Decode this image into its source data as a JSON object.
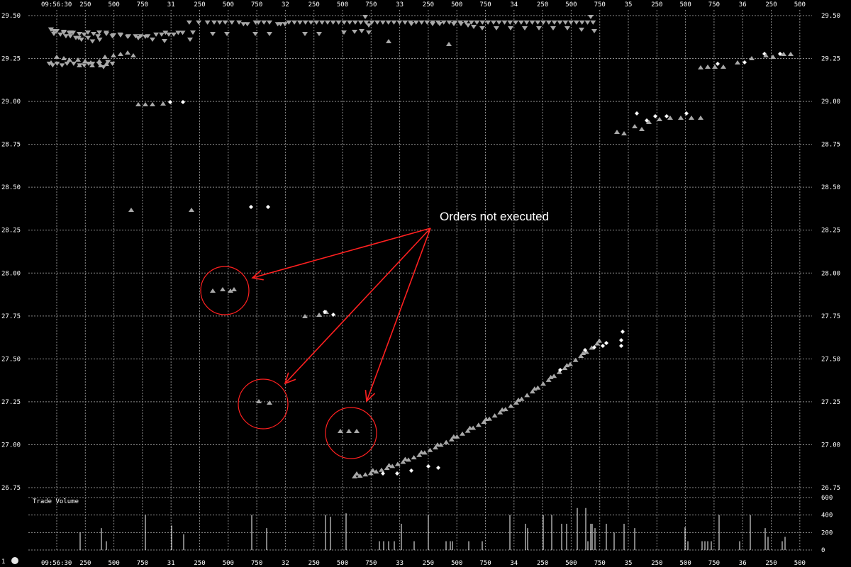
{
  "chart_data": [
    {
      "type": "scatter",
      "title": "",
      "xlabel": "",
      "ylabel": "",
      "ylim": [
        26.75,
        29.5
      ],
      "y_ticks": [
        "29.50",
        "29.25",
        "29.00",
        "28.75",
        "28.50",
        "28.25",
        "28.00",
        "27.75",
        "27.50",
        "27.25",
        "27.00",
        "26.75"
      ],
      "x_tick_labels": [
        "09:56:30",
        "250",
        "500",
        "750",
        "31",
        "250",
        "500",
        "750",
        "32",
        "250",
        "500",
        "750",
        "33",
        "250",
        "500",
        "750",
        "34",
        "250",
        "500",
        "750",
        "35",
        "250",
        "500",
        "750",
        "36",
        "250",
        "500"
      ],
      "grid": true,
      "series": [
        {
          "marker": "triangle-down",
          "color": "#a8a8a8",
          "points": [
            [
              0.5,
              29.42
            ],
            [
              1.0,
              29.41
            ],
            [
              1.5,
              29.41
            ],
            [
              2.2,
              29.39
            ],
            [
              2.8,
              29.4
            ],
            [
              3.2,
              29.38
            ],
            [
              3.8,
              29.4
            ],
            [
              4.0,
              29.38
            ],
            [
              4.5,
              29.4
            ],
            [
              5.0,
              29.37
            ],
            [
              5.5,
              29.37
            ],
            [
              6.0,
              29.36
            ],
            [
              6.5,
              29.39
            ],
            [
              7.2,
              29.37
            ],
            [
              8.0,
              29.35
            ],
            [
              9.0,
              29.38
            ],
            [
              9.3,
              29.36
            ],
            [
              10.5,
              29.4
            ],
            [
              11.6,
              29.38
            ],
            [
              13.0,
              29.39
            ],
            [
              14.5,
              29.38
            ],
            [
              15.8,
              29.38
            ],
            [
              16.7,
              29.38
            ],
            [
              18.0,
              29.38
            ],
            [
              19.5,
              29.39
            ],
            [
              20.5,
              29.39
            ],
            [
              21.2,
              29.4
            ],
            [
              21.8,
              29.39
            ],
            [
              22.7,
              29.39
            ],
            [
              23.5,
              29.4
            ],
            [
              24.3,
              29.4
            ],
            [
              25.5,
              29.46
            ],
            [
              27.2,
              29.46
            ],
            [
              28.8,
              29.46
            ],
            [
              30.0,
              29.46
            ],
            [
              31.0,
              29.46
            ],
            [
              32.0,
              29.46
            ],
            [
              33.2,
              29.46
            ],
            [
              34.5,
              29.46
            ],
            [
              35.3,
              29.45
            ],
            [
              36.0,
              29.45
            ],
            [
              37.5,
              29.46
            ],
            [
              38.0,
              29.46
            ],
            [
              39.0,
              29.46
            ],
            [
              40.0,
              29.46
            ],
            [
              41.5,
              29.45
            ],
            [
              42.0,
              29.45
            ],
            [
              42.8,
              29.45
            ],
            [
              43.5,
              29.46
            ],
            [
              44.5,
              29.46
            ],
            [
              45.5,
              29.46
            ],
            [
              46.5,
              29.46
            ],
            [
              47.5,
              29.46
            ],
            [
              48.5,
              29.46
            ],
            [
              49.5,
              29.46
            ],
            [
              50.5,
              29.46
            ],
            [
              51.5,
              29.46
            ],
            [
              52.5,
              29.46
            ],
            [
              53.5,
              29.46
            ],
            [
              54.5,
              29.46
            ],
            [
              55.5,
              29.46
            ],
            [
              56.5,
              29.46
            ],
            [
              57.5,
              29.46
            ],
            [
              58.5,
              29.46
            ],
            [
              59.5,
              29.46
            ],
            [
              60.5,
              29.46
            ],
            [
              61.5,
              29.46
            ],
            [
              62.5,
              29.46
            ],
            [
              63.5,
              29.46
            ],
            [
              64.5,
              29.46
            ],
            [
              65.5,
              29.46
            ],
            [
              66.5,
              29.46
            ],
            [
              67.5,
              29.46
            ],
            [
              68.5,
              29.46
            ],
            [
              69.5,
              29.46
            ],
            [
              70.5,
              29.46
            ],
            [
              71.5,
              29.46
            ],
            [
              72.5,
              29.46
            ],
            [
              73.5,
              29.46
            ],
            [
              74.5,
              29.46
            ],
            [
              75.5,
              29.46
            ],
            [
              76.5,
              29.46
            ],
            [
              77.5,
              29.46
            ],
            [
              78.5,
              29.46
            ],
            [
              79.5,
              29.46
            ],
            [
              80.5,
              29.46
            ],
            [
              81.5,
              29.46
            ],
            [
              82.5,
              29.46
            ],
            [
              83.5,
              29.46
            ],
            [
              84.5,
              29.46
            ],
            [
              85.5,
              29.46
            ],
            [
              86.5,
              29.46
            ],
            [
              87.5,
              29.46
            ],
            [
              88.5,
              29.46
            ],
            [
              89.5,
              29.46
            ],
            [
              90.5,
              29.46
            ],
            [
              91.5,
              29.46
            ],
            [
              92.5,
              29.46
            ],
            [
              93.5,
              29.46
            ],
            [
              94.5,
              29.46
            ],
            [
              95.5,
              29.46
            ],
            [
              96.5,
              29.46
            ],
            [
              97.5,
              29.46
            ],
            [
              98.5,
              29.46
            ]
          ]
        },
        {
          "marker": "triangle-down",
          "color": "#a8a8a8",
          "points": [
            [
              0.2,
              29.22
            ],
            [
              0.8,
              29.21
            ],
            [
              1.6,
              29.22
            ],
            [
              2.5,
              29.21
            ],
            [
              3.4,
              29.22
            ],
            [
              4.6,
              29.22
            ],
            [
              5.7,
              29.21
            ],
            [
              6.5,
              29.21
            ],
            [
              7.3,
              29.22
            ],
            [
              8.0,
              29.22
            ],
            [
              9.2,
              29.22
            ],
            [
              10.0,
              29.2
            ],
            [
              10.8,
              29.23
            ],
            [
              11.6,
              29.22
            ]
          ]
        }
      ]
    },
    {
      "type": "bar",
      "title": "Trade Volume",
      "ylim": [
        0,
        600
      ],
      "y_ticks": [
        "600",
        "400",
        "200",
        "0"
      ],
      "values": []
    }
  ],
  "annotation": {
    "label": "Orders not executed",
    "color": "#ff2020"
  },
  "footer": {
    "left_label": "1",
    "indicator": "circle-icon"
  }
}
